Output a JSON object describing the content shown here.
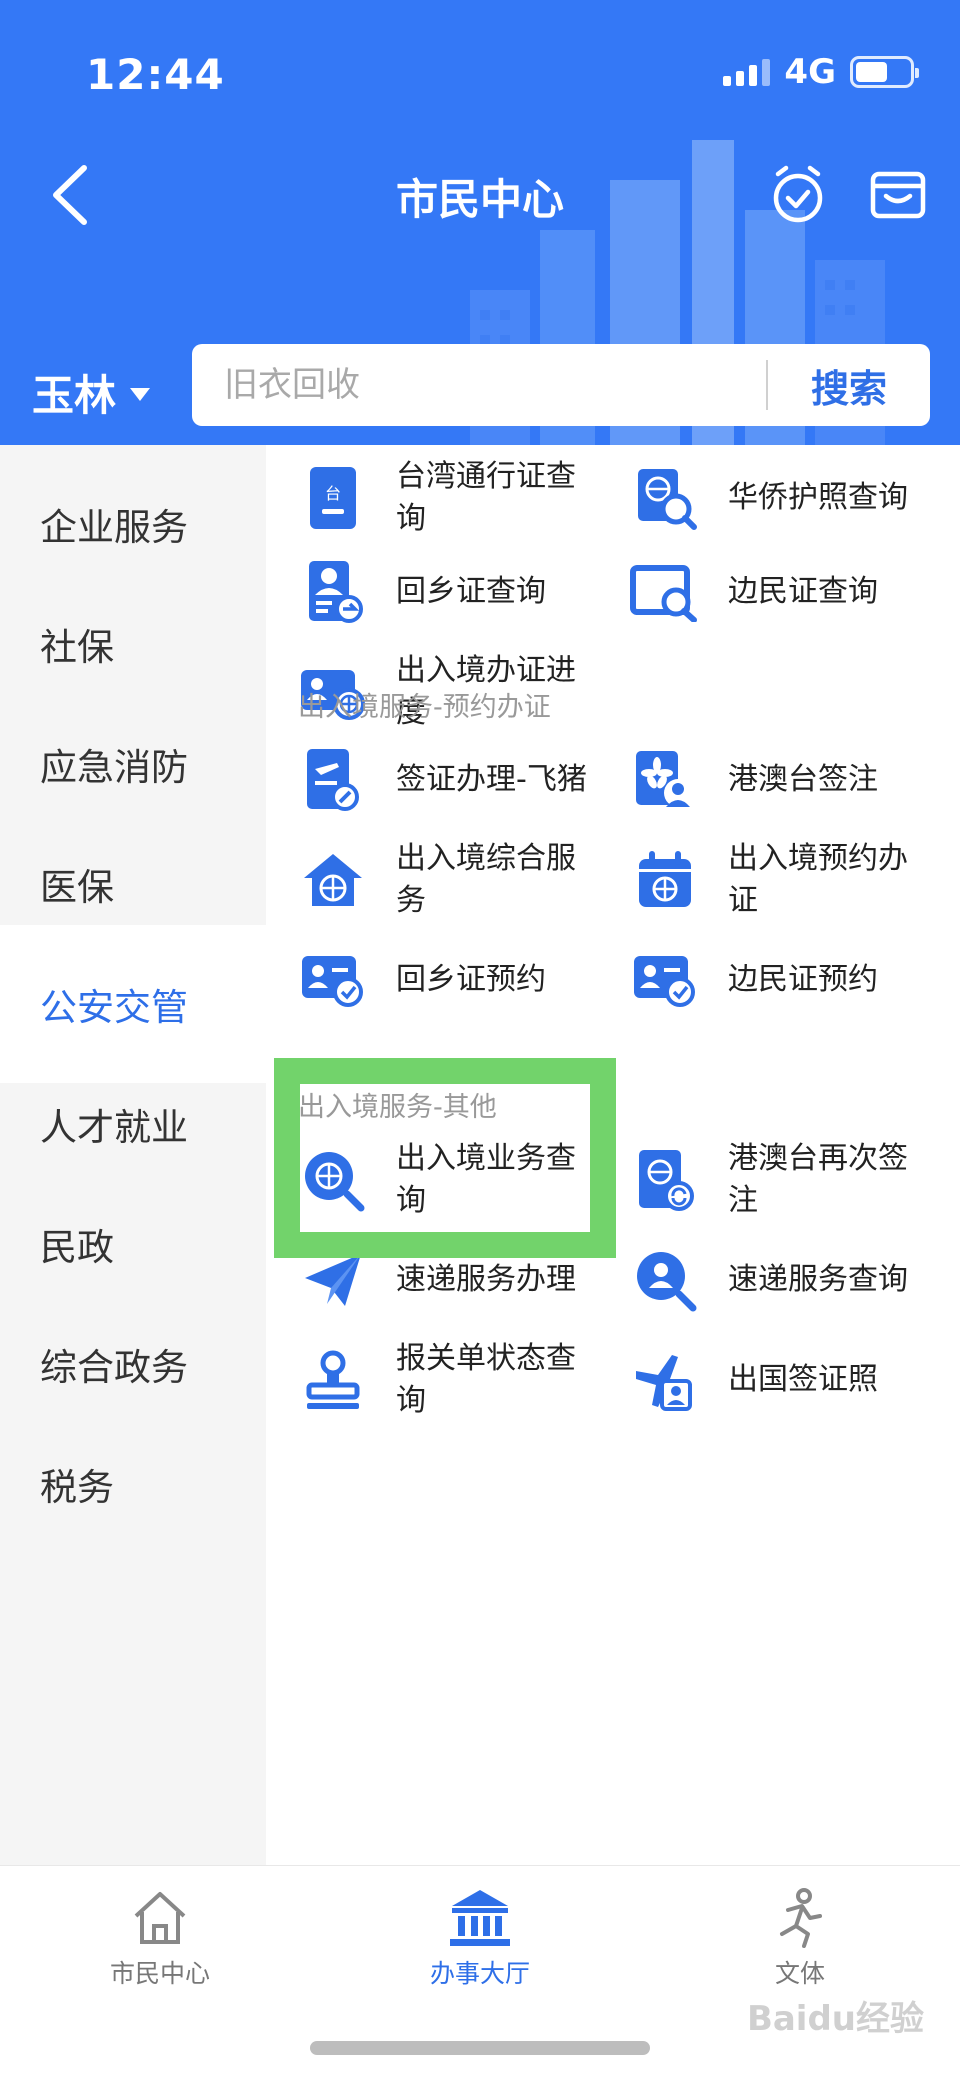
{
  "status": {
    "time": "12:44",
    "network": "4G"
  },
  "nav": {
    "title": "市民中心"
  },
  "location": {
    "city": "玉林"
  },
  "search": {
    "placeholder": "旧衣回收",
    "button_label": "搜索"
  },
  "sidebar": {
    "items": [
      {
        "label": "企业服务"
      },
      {
        "label": "社保"
      },
      {
        "label": "应急消防"
      },
      {
        "label": "医保"
      },
      {
        "label": "公安交管"
      },
      {
        "label": "人才就业"
      },
      {
        "label": "民政"
      },
      {
        "label": "综合政务"
      },
      {
        "label": "税务"
      }
    ],
    "active_label": "公安交管"
  },
  "services": {
    "group1": [
      {
        "label": "台湾通行证查询",
        "icon": "taiwan-permit-icon"
      },
      {
        "label": "华侨护照查询",
        "icon": "passport-search-icon"
      },
      {
        "label": "回乡证查询",
        "icon": "home-return-permit-icon"
      },
      {
        "label": "边民证查询",
        "icon": "border-card-search-icon"
      },
      {
        "label": "出入境办证进度",
        "icon": "id-globe-icon"
      }
    ],
    "section2_title": "出入境服务-预约办证",
    "group2": [
      {
        "label": "签证办理-飞猪",
        "icon": "visa-flight-icon"
      },
      {
        "label": "港澳台签注",
        "icon": "bauhinia-user-icon"
      },
      {
        "label": "出入境综合服务",
        "icon": "house-globe-icon"
      },
      {
        "label": "出入境预约办证",
        "icon": "calendar-globe-icon"
      },
      {
        "label": "回乡证预约",
        "icon": "card-check-icon"
      },
      {
        "label": "边民证预约",
        "icon": "card-check-icon"
      }
    ],
    "section3_title": "出入境服务-其他",
    "group3": [
      {
        "label": "出入境业务查询",
        "icon": "globe-search-icon"
      },
      {
        "label": "港澳台再次签注",
        "icon": "globe-refresh-icon"
      },
      {
        "label": "速递服务办理",
        "icon": "paper-plane-icon"
      },
      {
        "label": "速递服务查询",
        "icon": "user-search-icon"
      },
      {
        "label": "报关单状态查询",
        "icon": "stamp-icon"
      },
      {
        "label": "出国签证照",
        "icon": "plane-user-icon"
      }
    ]
  },
  "tabbar": {
    "items": [
      {
        "label": "市民中心",
        "icon": "home-icon"
      },
      {
        "label": "办事大厅",
        "icon": "government-building-icon"
      },
      {
        "label": "文体",
        "icon": "runner-icon"
      }
    ],
    "active_label": "办事大厅"
  },
  "watermark": "Baidu经验",
  "colors": {
    "primary": "#3478f6",
    "accent_text": "#2e6fe8",
    "highlight_box": "#72d36b",
    "sidebar_bg": "#f5f5f5"
  }
}
